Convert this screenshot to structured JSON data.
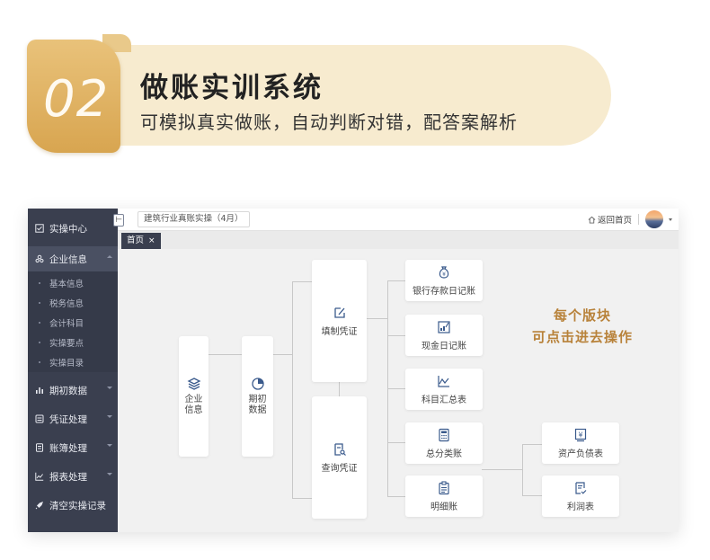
{
  "banner": {
    "number": "02",
    "title": "做账实训系统",
    "subtitle": "可模拟真实做账，自动判断对错，配答案解析"
  },
  "sidebar": {
    "items": [
      {
        "label": "实操中心",
        "icon": "checklist-icon"
      },
      {
        "label": "企业信息",
        "icon": "group-icon",
        "expanded": true
      },
      {
        "label": "期初数据",
        "icon": "bar-chart-icon"
      },
      {
        "label": "凭证处理",
        "icon": "voucher-icon"
      },
      {
        "label": "账簿处理",
        "icon": "ledger-icon"
      },
      {
        "label": "报表处理",
        "icon": "line-chart-icon"
      },
      {
        "label": "清空实操记录",
        "icon": "rocket-icon"
      }
    ],
    "subitems": [
      "基本信息",
      "税务信息",
      "会计科目",
      "实操要点",
      "实操目录"
    ]
  },
  "topbar": {
    "collapse_glyph": "⊢",
    "breadcrumb": "建筑行业真账实操（4月）",
    "home_link": "返回首页"
  },
  "tabs": [
    {
      "label": "首页",
      "close": "×"
    }
  ],
  "flow": {
    "company_info": "企业信息",
    "opening_data": "期初数据",
    "fill_voucher": "填制凭证",
    "query_voucher": "查询凭证",
    "bank_journal": "银行存款日记账",
    "cash_journal": "现金日记账",
    "subject_summary": "科目汇总表",
    "general_ledger": "总分类账",
    "detail_ledger": "明细账",
    "balance_sheet": "资产负债表",
    "income_statement": "利润表"
  },
  "promo": {
    "line1": "每个版块",
    "line2": "可点击进去操作"
  },
  "colors": {
    "sidebar": "#3a3f4f",
    "accent_gold": "#d8a550",
    "promo_text": "#b8823a",
    "banner_bg": "#f7ebcf",
    "icon_blue": "#3a5a8c"
  }
}
